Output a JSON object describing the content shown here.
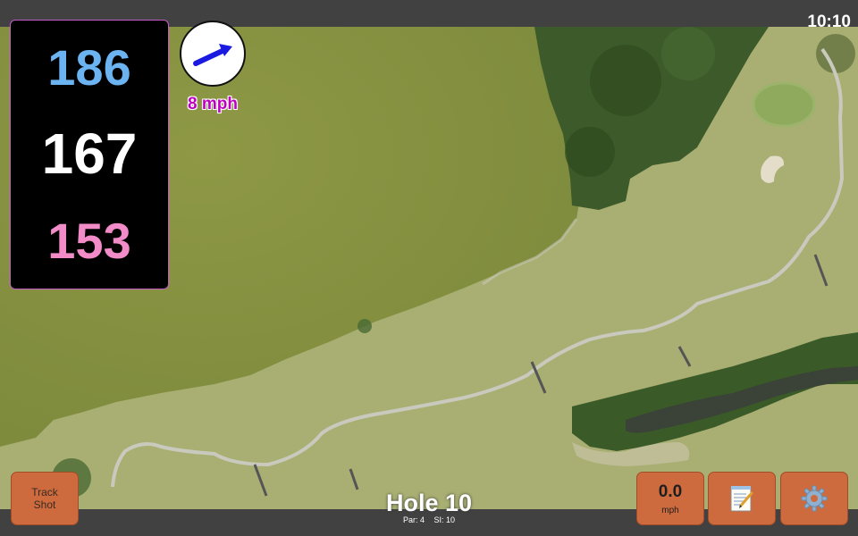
{
  "status_bar": {
    "time": "10:10"
  },
  "distances": {
    "back": "186",
    "center": "167",
    "front": "153",
    "colors": {
      "back": "#6cb3f2",
      "center": "#ffffff",
      "front": "#f28cc8"
    }
  },
  "wind": {
    "speed_label": "8 mph",
    "arrow_icon": "wind-direction-arrow-icon",
    "color": "#c000c0"
  },
  "hole": {
    "title": "Hole 10",
    "par": "Par: 4",
    "stroke_index": "SI: 10"
  },
  "buttons": {
    "track_shot_line1": "Track",
    "track_shot_line2": "Shot",
    "speed_value": "0.0",
    "speed_unit": "mph",
    "notes_icon": "notepad-icon",
    "settings_icon": "gear-icon"
  },
  "colors": {
    "button": "#cd6b3e",
    "panel_border": "#c45cc8"
  }
}
